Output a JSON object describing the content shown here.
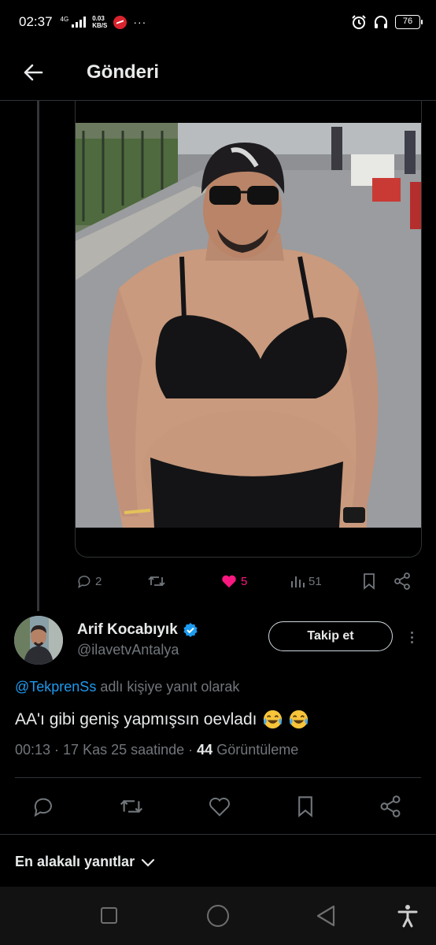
{
  "status_bar": {
    "time": "02:37",
    "network": "4G",
    "speed_value": "0.03",
    "speed_unit": "KB/S",
    "more": "···",
    "battery": "76"
  },
  "header": {
    "title": "Gönderi"
  },
  "parent_post": {
    "stats": {
      "replies": "2",
      "reposts": "",
      "likes": "5",
      "views": "51"
    }
  },
  "main_post": {
    "author_name": "Arif Kocabıyık",
    "author_handle": "@ilavetvAntalya",
    "follow_label": "Takip et",
    "reply_mention": "@TekprenSs",
    "reply_suffix": " adlı kişiye yanıt olarak",
    "text": "AA'ı gibi geniş yapmışsın oevladı",
    "time": "00:13",
    "date": " · 17 Kas 25 saatinde · ",
    "views_count": "44",
    "views_label": " Görüntüleme"
  },
  "sort": {
    "label": "En alakalı yanıtlar"
  },
  "colors": {
    "accent": "#1d9bf0",
    "like": "#f91880",
    "muted": "#71767b",
    "verified": "#1d9bf0"
  },
  "icons": [
    "back-arrow-icon",
    "reply-icon",
    "repost-icon",
    "heart-icon",
    "views-icon",
    "bookmark-icon",
    "share-icon",
    "verified-badge-icon",
    "more-icon",
    "chevron-down-icon",
    "alarm-icon",
    "headphones-icon",
    "signal-icon",
    "recent-apps-icon",
    "home-icon",
    "back-icon",
    "accessibility-icon"
  ]
}
